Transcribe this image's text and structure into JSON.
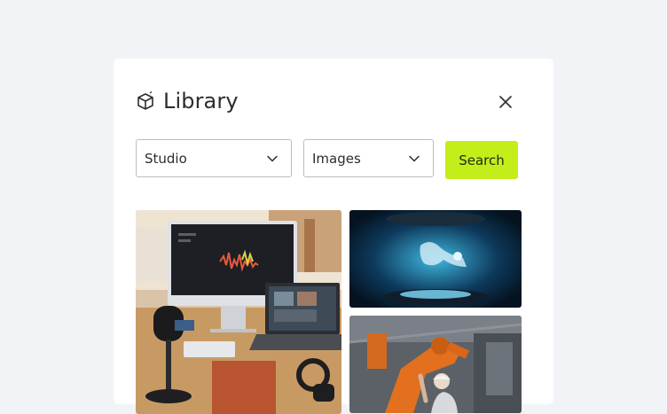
{
  "dialog": {
    "title": "Library",
    "icon": "box-icon",
    "close_icon": "close-icon"
  },
  "filters": {
    "source": {
      "value": "Studio"
    },
    "type": {
      "value": "Images"
    },
    "search_label": "Search"
  },
  "colors": {
    "background": "#f2f3f6",
    "panel": "#ffffff",
    "accent": "#c4ee1a",
    "text": "#2a2d31",
    "border": "#b8bcc4"
  },
  "images": [
    {
      "name": "podcast-studio-desk-image"
    },
    {
      "name": "robot-hologram-image"
    },
    {
      "name": "industrial-robot-arm-image"
    }
  ]
}
